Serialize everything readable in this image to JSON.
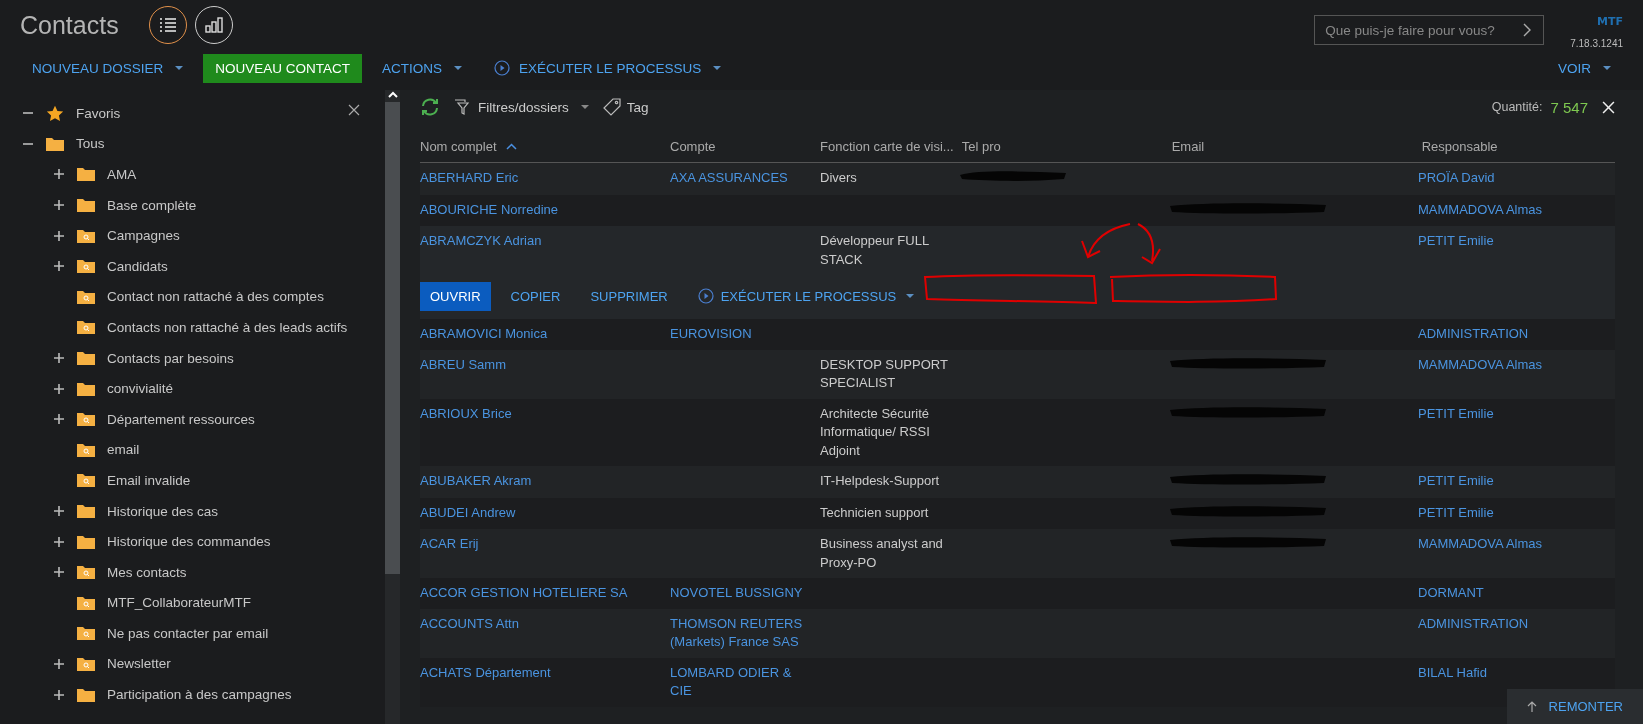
{
  "header": {
    "title": "Contacts",
    "views": [
      {
        "kind": "list",
        "selected": true
      },
      {
        "kind": "chart",
        "selected": false
      }
    ],
    "search": {
      "placeholder": "Que puis-je faire pour vous?"
    },
    "logo": "MTF",
    "version": "7.18.3.1241"
  },
  "toolbar": {
    "items": [
      {
        "kind": "menu",
        "label": "NOUVEAU DOSSIER"
      },
      {
        "kind": "primary",
        "label": "NOUVEAU CONTACT"
      },
      {
        "kind": "menu",
        "label": "ACTIONS"
      },
      {
        "kind": "process",
        "label": "EXÉCUTER LE PROCESSUS"
      }
    ],
    "view_menu": "VOIR"
  },
  "sidebar": {
    "items": [
      {
        "label": "Favoris",
        "kind": "star",
        "expanded": true
      },
      {
        "label": "Tous",
        "kind": "folder",
        "expanded": true,
        "children": [
          {
            "label": "AMA",
            "kind": "folder",
            "expandable": true
          },
          {
            "label": "Base complète",
            "kind": "folder",
            "expandable": true
          },
          {
            "label": "Campagnes",
            "kind": "search-folder",
            "expandable": true
          },
          {
            "label": "Candidats",
            "kind": "search-folder",
            "expandable": true
          },
          {
            "label": "Contact non rattaché à des comptes",
            "kind": "search-folder",
            "expandable": false
          },
          {
            "label": "Contacts non rattaché à des leads actifs",
            "kind": "search-folder",
            "expandable": false
          },
          {
            "label": "Contacts par besoins",
            "kind": "folder",
            "expandable": true
          },
          {
            "label": "convivialité",
            "kind": "folder",
            "expandable": true
          },
          {
            "label": "Département ressources",
            "kind": "search-folder",
            "expandable": true
          },
          {
            "label": "email",
            "kind": "search-folder",
            "expandable": false
          },
          {
            "label": "Email invalide",
            "kind": "search-folder",
            "expandable": false
          },
          {
            "label": "Historique des cas",
            "kind": "folder",
            "expandable": true
          },
          {
            "label": "Historique des commandes",
            "kind": "folder",
            "expandable": true
          },
          {
            "label": "Mes contacts",
            "kind": "search-folder",
            "expandable": true
          },
          {
            "label": "MTF_CollaborateurMTF",
            "kind": "search-folder",
            "expandable": false
          },
          {
            "label": "Ne pas contacter par email",
            "kind": "search-folder",
            "expandable": false
          },
          {
            "label": "Newsletter",
            "kind": "search-folder",
            "expandable": true
          },
          {
            "label": "Participation à des campagnes",
            "kind": "folder",
            "expandable": true
          }
        ]
      }
    ]
  },
  "list_toolbar": {
    "filter": "Filtres/dossiers",
    "tag": "Tag",
    "quantity_label": "Quantité:",
    "quantity": "7 547"
  },
  "table": {
    "columns": [
      {
        "label": "Nom complet",
        "sorted": true
      },
      {
        "label": "Compte",
        "sorted": false
      },
      {
        "label": "Fonction carte de visi...",
        "sorted": false
      },
      {
        "label": "Tel pro",
        "sorted": false
      },
      {
        "label": "Email",
        "sorted": false
      },
      {
        "label": "Responsable",
        "sorted": false
      }
    ],
    "rows": [
      {
        "name": "ABERHARD Eric",
        "account": "AXA ASSURANCES",
        "function": "Divers",
        "tel_redacted": true,
        "email_redacted": false,
        "owner": "PROÏA David",
        "selected": false
      },
      {
        "name": "ABOURICHE Norredine",
        "account": "",
        "function": "",
        "tel_redacted": false,
        "email_redacted": true,
        "owner": "MAMMADOVA Almas",
        "selected": false
      },
      {
        "name": "ABRAMCZYK Adrian",
        "account": "",
        "function": "Développeur FULL STACK",
        "tel_redacted": false,
        "email_redacted": false,
        "owner": "PETIT Emilie",
        "selected": true
      },
      {
        "name": "ABRAMOVICI Monica",
        "account": "EUROVISION",
        "function": "",
        "tel_redacted": false,
        "email_redacted": false,
        "owner": "ADMINISTRATION",
        "selected": false
      },
      {
        "name": "ABREU Samm",
        "account": "",
        "function": "DESKTOP SUPPORT SPECIALIST",
        "tel_redacted": false,
        "email_redacted": true,
        "owner": "MAMMADOVA Almas",
        "selected": false
      },
      {
        "name": "ABRIOUX Brice",
        "account": "",
        "function": "Architecte Sécurité Informatique/ RSSI Adjoint",
        "tel_redacted": false,
        "email_redacted": true,
        "owner": "PETIT Emilie",
        "selected": false
      },
      {
        "name": "ABUBAKER Akram",
        "account": "",
        "function": "IT-Helpdesk-Support",
        "tel_redacted": false,
        "email_redacted": true,
        "owner": "PETIT Emilie",
        "selected": false
      },
      {
        "name": "ABUDEI Andrew",
        "account": "",
        "function": "Technicien support",
        "tel_redacted": false,
        "email_redacted": true,
        "owner": "PETIT Emilie",
        "selected": false
      },
      {
        "name": "ACAR Erij",
        "account": "",
        "function": "Business analyst and Proxy-PO",
        "tel_redacted": false,
        "email_redacted": true,
        "owner": "MAMMADOVA Almas",
        "selected": false
      },
      {
        "name": "ACCOR GESTION HOTELIERE SA",
        "account": "NOVOTEL BUSSIGNY",
        "function": "",
        "tel_redacted": false,
        "email_redacted": false,
        "owner": "DORMANT",
        "selected": false
      },
      {
        "name": "ACCOUNTS Attn",
        "account": "THOMSON REUTERS (Markets) France SAS",
        "function": "",
        "tel_redacted": false,
        "email_redacted": false,
        "owner": "ADMINISTRATION",
        "selected": false
      },
      {
        "name": "ACHATS Département",
        "account": "LOMBARD ODIER & CIE",
        "function": "",
        "tel_redacted": false,
        "email_redacted": false,
        "owner": "BILAL Hafid",
        "selected": false
      }
    ],
    "row_actions": [
      {
        "kind": "primary",
        "label": "OUVRIR"
      },
      {
        "kind": "plain",
        "label": "COPIER"
      },
      {
        "kind": "plain",
        "label": "SUPPRIMER"
      },
      {
        "kind": "process",
        "label": "EXÉCUTER LE PROCESSUS"
      }
    ]
  },
  "scroll_top": "REMONTER"
}
